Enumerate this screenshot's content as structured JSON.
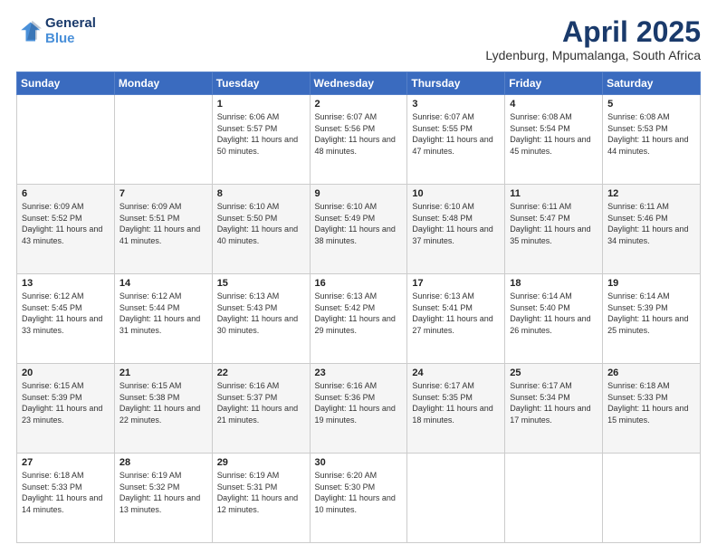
{
  "logo": {
    "line1": "General",
    "line2": "Blue"
  },
  "title": "April 2025",
  "subtitle": "Lydenburg, Mpumalanga, South Africa",
  "headers": [
    "Sunday",
    "Monday",
    "Tuesday",
    "Wednesday",
    "Thursday",
    "Friday",
    "Saturday"
  ],
  "weeks": [
    [
      {
        "day": "",
        "sunrise": "",
        "sunset": "",
        "daylight": ""
      },
      {
        "day": "",
        "sunrise": "",
        "sunset": "",
        "daylight": ""
      },
      {
        "day": "1",
        "sunrise": "Sunrise: 6:06 AM",
        "sunset": "Sunset: 5:57 PM",
        "daylight": "Daylight: 11 hours and 50 minutes."
      },
      {
        "day": "2",
        "sunrise": "Sunrise: 6:07 AM",
        "sunset": "Sunset: 5:56 PM",
        "daylight": "Daylight: 11 hours and 48 minutes."
      },
      {
        "day": "3",
        "sunrise": "Sunrise: 6:07 AM",
        "sunset": "Sunset: 5:55 PM",
        "daylight": "Daylight: 11 hours and 47 minutes."
      },
      {
        "day": "4",
        "sunrise": "Sunrise: 6:08 AM",
        "sunset": "Sunset: 5:54 PM",
        "daylight": "Daylight: 11 hours and 45 minutes."
      },
      {
        "day": "5",
        "sunrise": "Sunrise: 6:08 AM",
        "sunset": "Sunset: 5:53 PM",
        "daylight": "Daylight: 11 hours and 44 minutes."
      }
    ],
    [
      {
        "day": "6",
        "sunrise": "Sunrise: 6:09 AM",
        "sunset": "Sunset: 5:52 PM",
        "daylight": "Daylight: 11 hours and 43 minutes."
      },
      {
        "day": "7",
        "sunrise": "Sunrise: 6:09 AM",
        "sunset": "Sunset: 5:51 PM",
        "daylight": "Daylight: 11 hours and 41 minutes."
      },
      {
        "day": "8",
        "sunrise": "Sunrise: 6:10 AM",
        "sunset": "Sunset: 5:50 PM",
        "daylight": "Daylight: 11 hours and 40 minutes."
      },
      {
        "day": "9",
        "sunrise": "Sunrise: 6:10 AM",
        "sunset": "Sunset: 5:49 PM",
        "daylight": "Daylight: 11 hours and 38 minutes."
      },
      {
        "day": "10",
        "sunrise": "Sunrise: 6:10 AM",
        "sunset": "Sunset: 5:48 PM",
        "daylight": "Daylight: 11 hours and 37 minutes."
      },
      {
        "day": "11",
        "sunrise": "Sunrise: 6:11 AM",
        "sunset": "Sunset: 5:47 PM",
        "daylight": "Daylight: 11 hours and 35 minutes."
      },
      {
        "day": "12",
        "sunrise": "Sunrise: 6:11 AM",
        "sunset": "Sunset: 5:46 PM",
        "daylight": "Daylight: 11 hours and 34 minutes."
      }
    ],
    [
      {
        "day": "13",
        "sunrise": "Sunrise: 6:12 AM",
        "sunset": "Sunset: 5:45 PM",
        "daylight": "Daylight: 11 hours and 33 minutes."
      },
      {
        "day": "14",
        "sunrise": "Sunrise: 6:12 AM",
        "sunset": "Sunset: 5:44 PM",
        "daylight": "Daylight: 11 hours and 31 minutes."
      },
      {
        "day": "15",
        "sunrise": "Sunrise: 6:13 AM",
        "sunset": "Sunset: 5:43 PM",
        "daylight": "Daylight: 11 hours and 30 minutes."
      },
      {
        "day": "16",
        "sunrise": "Sunrise: 6:13 AM",
        "sunset": "Sunset: 5:42 PM",
        "daylight": "Daylight: 11 hours and 29 minutes."
      },
      {
        "day": "17",
        "sunrise": "Sunrise: 6:13 AM",
        "sunset": "Sunset: 5:41 PM",
        "daylight": "Daylight: 11 hours and 27 minutes."
      },
      {
        "day": "18",
        "sunrise": "Sunrise: 6:14 AM",
        "sunset": "Sunset: 5:40 PM",
        "daylight": "Daylight: 11 hours and 26 minutes."
      },
      {
        "day": "19",
        "sunrise": "Sunrise: 6:14 AM",
        "sunset": "Sunset: 5:39 PM",
        "daylight": "Daylight: 11 hours and 25 minutes."
      }
    ],
    [
      {
        "day": "20",
        "sunrise": "Sunrise: 6:15 AM",
        "sunset": "Sunset: 5:39 PM",
        "daylight": "Daylight: 11 hours and 23 minutes."
      },
      {
        "day": "21",
        "sunrise": "Sunrise: 6:15 AM",
        "sunset": "Sunset: 5:38 PM",
        "daylight": "Daylight: 11 hours and 22 minutes."
      },
      {
        "day": "22",
        "sunrise": "Sunrise: 6:16 AM",
        "sunset": "Sunset: 5:37 PM",
        "daylight": "Daylight: 11 hours and 21 minutes."
      },
      {
        "day": "23",
        "sunrise": "Sunrise: 6:16 AM",
        "sunset": "Sunset: 5:36 PM",
        "daylight": "Daylight: 11 hours and 19 minutes."
      },
      {
        "day": "24",
        "sunrise": "Sunrise: 6:17 AM",
        "sunset": "Sunset: 5:35 PM",
        "daylight": "Daylight: 11 hours and 18 minutes."
      },
      {
        "day": "25",
        "sunrise": "Sunrise: 6:17 AM",
        "sunset": "Sunset: 5:34 PM",
        "daylight": "Daylight: 11 hours and 17 minutes."
      },
      {
        "day": "26",
        "sunrise": "Sunrise: 6:18 AM",
        "sunset": "Sunset: 5:33 PM",
        "daylight": "Daylight: 11 hours and 15 minutes."
      }
    ],
    [
      {
        "day": "27",
        "sunrise": "Sunrise: 6:18 AM",
        "sunset": "Sunset: 5:33 PM",
        "daylight": "Daylight: 11 hours and 14 minutes."
      },
      {
        "day": "28",
        "sunrise": "Sunrise: 6:19 AM",
        "sunset": "Sunset: 5:32 PM",
        "daylight": "Daylight: 11 hours and 13 minutes."
      },
      {
        "day": "29",
        "sunrise": "Sunrise: 6:19 AM",
        "sunset": "Sunset: 5:31 PM",
        "daylight": "Daylight: 11 hours and 12 minutes."
      },
      {
        "day": "30",
        "sunrise": "Sunrise: 6:20 AM",
        "sunset": "Sunset: 5:30 PM",
        "daylight": "Daylight: 11 hours and 10 minutes."
      },
      {
        "day": "",
        "sunrise": "",
        "sunset": "",
        "daylight": ""
      },
      {
        "day": "",
        "sunrise": "",
        "sunset": "",
        "daylight": ""
      },
      {
        "day": "",
        "sunrise": "",
        "sunset": "",
        "daylight": ""
      }
    ]
  ]
}
